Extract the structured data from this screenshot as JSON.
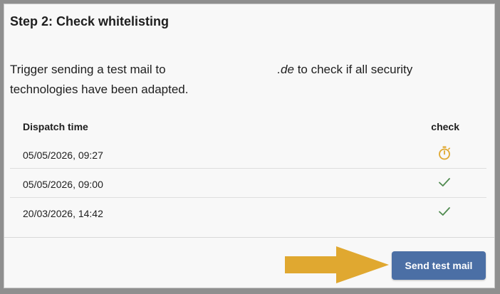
{
  "step": {
    "title": "Step 2: Check whitelisting",
    "description_before": "Trigger sending a test mail to",
    "description_domain": ".de",
    "description_after": "to check if all security technologies have been adapted."
  },
  "table": {
    "headers": {
      "time": "Dispatch time",
      "check": "check"
    },
    "rows": [
      {
        "time": "05/05/2026, 09:27",
        "status_icon": "stopwatch-icon",
        "status": "pending"
      },
      {
        "time": "05/05/2026, 09:00",
        "status_icon": "checkmark-icon",
        "status": "ok"
      },
      {
        "time": "20/03/2026, 14:42",
        "status_icon": "checkmark-icon",
        "status": "ok"
      }
    ]
  },
  "actions": {
    "send_label": "Send test mail",
    "arrow_icon": "arrow-right-icon"
  },
  "colors": {
    "button": "#4b6fa5",
    "pending": "#e0a830",
    "ok": "#4f8a4f",
    "arrow": "#e0a830"
  }
}
